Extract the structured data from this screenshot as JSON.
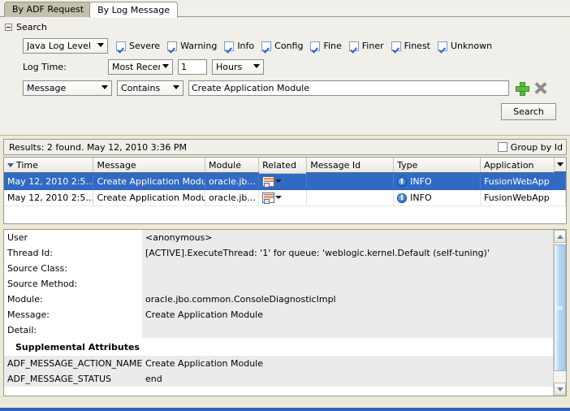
{
  "tabs": [
    {
      "label": "By ADF Request",
      "active": false
    },
    {
      "label": "By Log Message",
      "active": true
    }
  ],
  "search": {
    "title": "Search",
    "collapse_icon": "minus-box-icon",
    "level_select": "Java Log Level",
    "levels": [
      {
        "label": "Severe",
        "checked": true
      },
      {
        "label": "Warning",
        "checked": true
      },
      {
        "label": "Info",
        "checked": true
      },
      {
        "label": "Config",
        "checked": true
      },
      {
        "label": "Fine",
        "checked": true
      },
      {
        "label": "Finer",
        "checked": true
      },
      {
        "label": "Finest",
        "checked": true
      },
      {
        "label": "Unknown",
        "checked": true
      }
    ],
    "log_time_label": "Log Time:",
    "recency_select": "Most Recent",
    "amount_value": "1",
    "unit_select": "Hours",
    "field_select": "Message",
    "operator_select": "Contains",
    "query_value": "Create Application Module",
    "add_icon": "plus-icon",
    "remove_icon": "x-icon",
    "search_button": "Search"
  },
  "results": {
    "status": "Results:  2 found. May 12, 2010 3:36 PM",
    "group_by_id_label": "Group by Id",
    "group_by_id_checked": false,
    "columns": [
      "Time",
      "Message",
      "Module",
      "Related",
      "Message Id",
      "Type",
      "Application"
    ],
    "sorted_column": "Time",
    "sort_direction": "descending",
    "rows": [
      {
        "time": "May 12, 2010 2:5...",
        "message": "Create Application Module",
        "module": "oracle.jb...",
        "related": "related-report-icon",
        "message_id": "",
        "type": "INFO",
        "type_icon": "info-icon",
        "application": "FusionWebApp",
        "selected": true
      },
      {
        "time": "May 12, 2010 2:5...",
        "message": "Create Application Module",
        "module": "oracle.jb...",
        "related": "related-report-icon",
        "message_id": "",
        "type": "INFO",
        "type_icon": "info-icon",
        "application": "FusionWebApp",
        "selected": false
      }
    ]
  },
  "detail": {
    "fields": [
      {
        "key": "User",
        "value": "<anonymous>"
      },
      {
        "key": "Thread Id:",
        "value": "[ACTIVE].ExecuteThread: '1' for queue: 'weblogic.kernel.Default (self-tuning)'"
      },
      {
        "key": "Source Class:",
        "value": ""
      },
      {
        "key": "Source Method:",
        "value": ""
      },
      {
        "key": "Module:",
        "value": "oracle.jbo.common.ConsoleDiagnosticImpl"
      },
      {
        "key": "Message:",
        "value": "Create Application Module"
      },
      {
        "key": "Detail:",
        "value": ""
      }
    ],
    "section_title": "Supplemental Attributes",
    "attributes": [
      {
        "key": "ADF_MESSAGE_ACTION_NAME",
        "value": "Create Application Module"
      },
      {
        "key": "ADF_MESSAGE_STATUS",
        "value": "end"
      }
    ]
  },
  "colors": {
    "selection": "#316ac5",
    "accent": "#3a6ea5",
    "add": "#5fba46",
    "panel": "#f0efe9"
  }
}
